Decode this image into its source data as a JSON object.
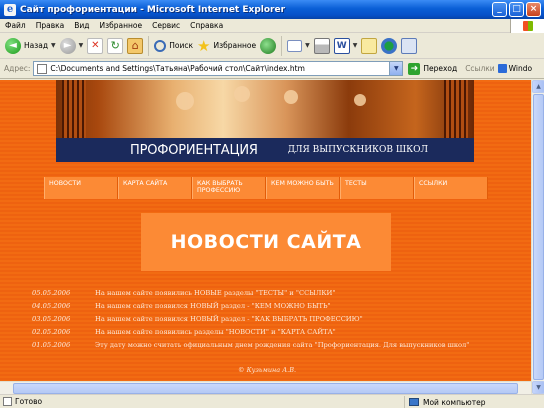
{
  "window": {
    "title": "Сайт профориентации - Microsoft Internet Explorer",
    "min": "_",
    "max": "□",
    "close": "×"
  },
  "menu": [
    "Файл",
    "Правка",
    "Вид",
    "Избранное",
    "Сервис",
    "Справка"
  ],
  "toolbar": {
    "back": "Назад",
    "search": "Поиск",
    "favorites": "Избранное"
  },
  "address": {
    "label": "Адрес:",
    "value": "C:\\Documents and Settings\\Татьяна\\Рабочий стол\\Сайт\\index.htm",
    "go": "Переход",
    "links": "Ссылки",
    "winds": "Windo"
  },
  "banner": {
    "title": "ПРОФОРИЕНТАЦИЯ",
    "subtitle": "ДЛЯ ВЫПУСКНИКОВ ШКОЛ"
  },
  "nav": [
    "НОВОСТИ",
    "КАРТА САЙТА",
    "КАК ВЫБРАТЬ ПРОФЕССИЮ",
    "КЕМ МОЖНО БЫТЬ",
    "ТЕСТЫ",
    "ССЫЛКИ"
  ],
  "heading": "НОВОСТИ САЙТА",
  "news": [
    {
      "date": "05.05.2006",
      "text": "На нашем сайте появились НОВЫЕ разделы \"ТЕСТЫ\" и \"ССЫЛКИ\""
    },
    {
      "date": "04.05.2006",
      "text": "На нашем сайте появился НОВЫЙ раздел - \"КЕМ МОЖНО БЫТЬ\""
    },
    {
      "date": "03.05.2006",
      "text": "На нашем сайте появился НОВЫЙ раздел - \"КАК ВЫБРАТЬ ПРОФЕССИЮ\""
    },
    {
      "date": "02.05.2006",
      "text": "На нашем сайте появились разделы \"НОВОСТИ\" и \"КАРТА САЙТА\""
    },
    {
      "date": "01.05.2006",
      "text": "Эту дату можно считать официальным днем рождения сайта \"Профориентация. Для выпускников школ\""
    }
  ],
  "copyright": "© Кузьмина А.В.",
  "status": {
    "text": "Готово",
    "zone": "Мой компьютер"
  },
  "colors": {
    "page_bg": "#f26b12",
    "nav_bg": "#fc8a35",
    "banner_band": "#1b2a5c",
    "title_bar": "#0a5fd6"
  }
}
